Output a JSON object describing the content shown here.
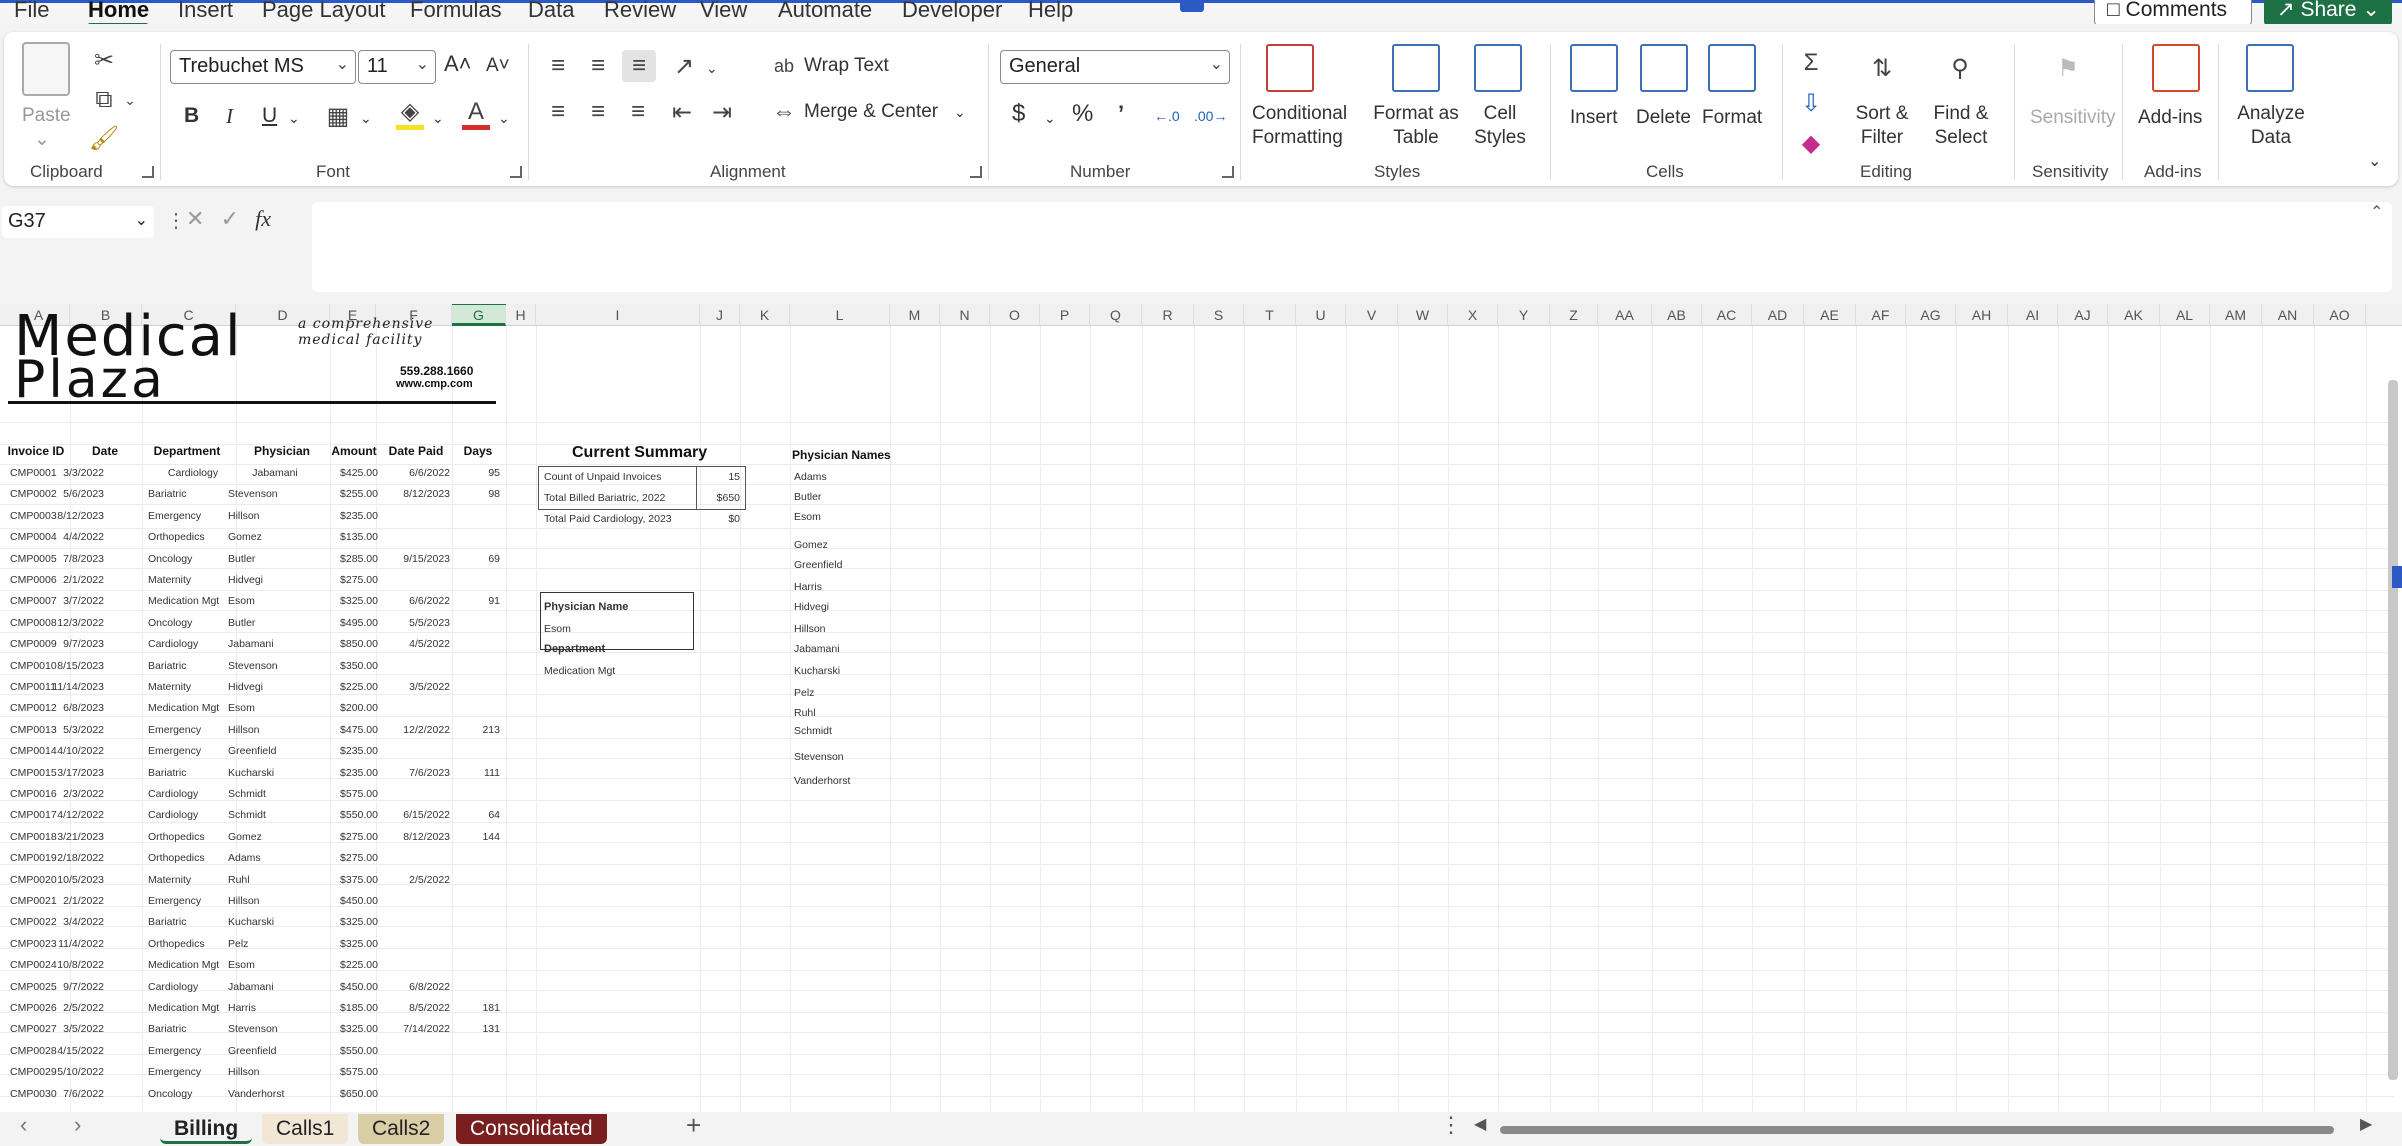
{
  "menu": {
    "items": [
      "File",
      "Home",
      "Insert",
      "Page Layout",
      "Formulas",
      "Data",
      "Review",
      "View",
      "Automate",
      "Developer",
      "Help"
    ],
    "active": "Home",
    "comments": "Comments",
    "share": "Share"
  },
  "ribbon": {
    "clipboard": {
      "label": "Clipboard",
      "paste": "Paste"
    },
    "font": {
      "label": "Font",
      "name": "Trebuchet MS",
      "size": "11",
      "bold": "B",
      "italic": "I",
      "underline": "U",
      "grow": "A˄",
      "shrink": "A˅"
    },
    "alignment": {
      "label": "Alignment",
      "wrap": "Wrap Text",
      "merge": "Merge & Center"
    },
    "number": {
      "label": "Number",
      "format": "General",
      "currency": "$",
      "percent": "%",
      "comma": "9"
    },
    "styles": {
      "label": "Styles",
      "conditional": "Conditional Formatting",
      "format_table": "Format as Table",
      "cell_styles": "Cell Styles"
    },
    "cells": {
      "label": "Cells",
      "insert": "Insert",
      "delete": "Delete",
      "format": "Format"
    },
    "editing": {
      "label": "Editing",
      "sort": "Sort & Filter",
      "find": "Find & Select"
    },
    "sensitivity": {
      "label": "Sensitivity",
      "btn": "Sensitivity"
    },
    "addins": {
      "label": "Add-ins",
      "btn": "Add-ins"
    },
    "analyze": {
      "btn": "Analyze Data"
    }
  },
  "formula_bar": {
    "name_box": "G37",
    "fx": "fx",
    "value": ""
  },
  "columns": [
    "A",
    "B",
    "C",
    "D",
    "E",
    "F",
    "G",
    "H",
    "I",
    "J",
    "K",
    "L",
    "M",
    "N",
    "O",
    "P",
    "Q",
    "R",
    "S",
    "T",
    "U",
    "V",
    "W",
    "X",
    "Y",
    "Z",
    "AA",
    "AB",
    "AC",
    "AD",
    "AE",
    "AF",
    "AG",
    "AH",
    "AI",
    "AJ",
    "AK",
    "AL",
    "AM",
    "AN",
    "AO"
  ],
  "selected_column": "G",
  "logo": {
    "line1": "Medical",
    "line2": "Plaza",
    "tagline1": "a comprehensive",
    "tagline2": "medical facility",
    "phone": "559.288.1660",
    "web": "www.cmp.com"
  },
  "table": {
    "headers": [
      "Invoice ID",
      "Date",
      "Department",
      "Physician",
      "Amount",
      "Date Paid",
      "Days"
    ],
    "rows": [
      [
        "CMP0001",
        "3/3/2022",
        "Cardiology",
        "Jabamani",
        "$425.00",
        "6/6/2022",
        "95"
      ],
      [
        "CMP0002",
        "5/6/2023",
        "Bariatric",
        "Stevenson",
        "$255.00",
        "8/12/2023",
        "98"
      ],
      [
        "CMP0003",
        "8/12/2023",
        "Emergency",
        "Hillson",
        "$235.00",
        "",
        ""
      ],
      [
        "CMP0004",
        "4/4/2022",
        "Orthopedics",
        "Gomez",
        "$135.00",
        "",
        ""
      ],
      [
        "CMP0005",
        "7/8/2023",
        "Oncology",
        "Butler",
        "$285.00",
        "9/15/2023",
        "69"
      ],
      [
        "CMP0006",
        "2/1/2022",
        "Maternity",
        "Hidvegi",
        "$275.00",
        "",
        ""
      ],
      [
        "CMP0007",
        "3/7/2022",
        "Medication Mgt",
        "Esom",
        "$325.00",
        "6/6/2022",
        "91"
      ],
      [
        "CMP0008",
        "12/3/2022",
        "Oncology",
        "Butler",
        "$495.00",
        "5/5/2023",
        ""
      ],
      [
        "CMP0009",
        "9/7/2023",
        "Cardiology",
        "Jabamani",
        "$850.00",
        "4/5/2022",
        ""
      ],
      [
        "CMP0010",
        "8/15/2023",
        "Bariatric",
        "Stevenson",
        "$350.00",
        "",
        ""
      ],
      [
        "CMP0011",
        "11/14/2023",
        "Maternity",
        "Hidvegi",
        "$225.00",
        "3/5/2022",
        ""
      ],
      [
        "CMP0012",
        "6/8/2023",
        "Medication Mgt",
        "Esom",
        "$200.00",
        "",
        ""
      ],
      [
        "CMP0013",
        "5/3/2022",
        "Emergency",
        "Hillson",
        "$475.00",
        "12/2/2022",
        "213"
      ],
      [
        "CMP0014",
        "4/10/2022",
        "Emergency",
        "Greenfield",
        "$235.00",
        "",
        ""
      ],
      [
        "CMP0015",
        "3/17/2023",
        "Bariatric",
        "Kucharski",
        "$235.00",
        "7/6/2023",
        "111"
      ],
      [
        "CMP0016",
        "2/3/2022",
        "Cardiology",
        "Schmidt",
        "$575.00",
        "",
        ""
      ],
      [
        "CMP0017",
        "4/12/2022",
        "Cardiology",
        "Schmidt",
        "$550.00",
        "6/15/2022",
        "64"
      ],
      [
        "CMP0018",
        "3/21/2023",
        "Orthopedics",
        "Gomez",
        "$275.00",
        "8/12/2023",
        "144"
      ],
      [
        "CMP0019",
        "2/18/2022",
        "Orthopedics",
        "Adams",
        "$275.00",
        "",
        ""
      ],
      [
        "CMP0020",
        "10/5/2023",
        "Maternity",
        "Ruhl",
        "$375.00",
        "2/5/2022",
        ""
      ],
      [
        "CMP0021",
        "2/1/2022",
        "Emergency",
        "Hillson",
        "$450.00",
        "",
        ""
      ],
      [
        "CMP0022",
        "3/4/2022",
        "Bariatric",
        "Kucharski",
        "$325.00",
        "",
        ""
      ],
      [
        "CMP0023",
        "11/4/2022",
        "Orthopedics",
        "Pelz",
        "$325.00",
        "",
        ""
      ],
      [
        "CMP0024",
        "10/8/2022",
        "Medication Mgt",
        "Esom",
        "$225.00",
        "",
        ""
      ],
      [
        "CMP0025",
        "9/7/2022",
        "Cardiology",
        "Jabamani",
        "$450.00",
        "6/8/2022",
        ""
      ],
      [
        "CMP0026",
        "2/5/2022",
        "Medication Mgt",
        "Harris",
        "$185.00",
        "8/5/2022",
        "181"
      ],
      [
        "CMP0027",
        "3/5/2022",
        "Bariatric",
        "Stevenson",
        "$325.00",
        "7/14/2022",
        "131"
      ],
      [
        "CMP0028",
        "4/15/2022",
        "Emergency",
        "Greenfield",
        "$550.00",
        "",
        ""
      ],
      [
        "CMP0029",
        "5/10/2022",
        "Emergency",
        "Hillson",
        "$575.00",
        "",
        ""
      ],
      [
        "CMP0030",
        "7/6/2022",
        "Oncology",
        "Vanderhorst",
        "$650.00",
        "",
        ""
      ]
    ]
  },
  "summary": {
    "title": "Current Summary",
    "rows": [
      [
        "Count of Unpaid Invoices",
        "15"
      ],
      [
        "Total Billed Bariatric, 2022",
        "$650"
      ],
      [
        "Total Paid Cardiology, 2023",
        "$0"
      ]
    ]
  },
  "lookup": {
    "physician_label": "Physician Name",
    "physician_value": "Esom",
    "department_label": "Department",
    "department_value": "Medication Mgt"
  },
  "physicians": {
    "title": "Physician Names",
    "names": [
      "Adams",
      "Butler",
      "Esom",
      "Gomez",
      "Greenfield",
      "Harris",
      "Hidvegi",
      "Hillson",
      "Jabamani",
      "Kucharski",
      "Pelz",
      "Ruhl",
      "Schmidt",
      "Stevenson",
      "Vanderhorst"
    ]
  },
  "sheets": {
    "tabs": [
      "Billing",
      "Calls1",
      "Calls2",
      "Consolidated"
    ],
    "active": "Billing",
    "colors": {
      "Billing": "#f3f3f3",
      "Calls1": "#f2e7d5",
      "Calls2": "#d9cda6",
      "Consolidated": "#7a1f1f"
    }
  },
  "accent": "#1e7145"
}
